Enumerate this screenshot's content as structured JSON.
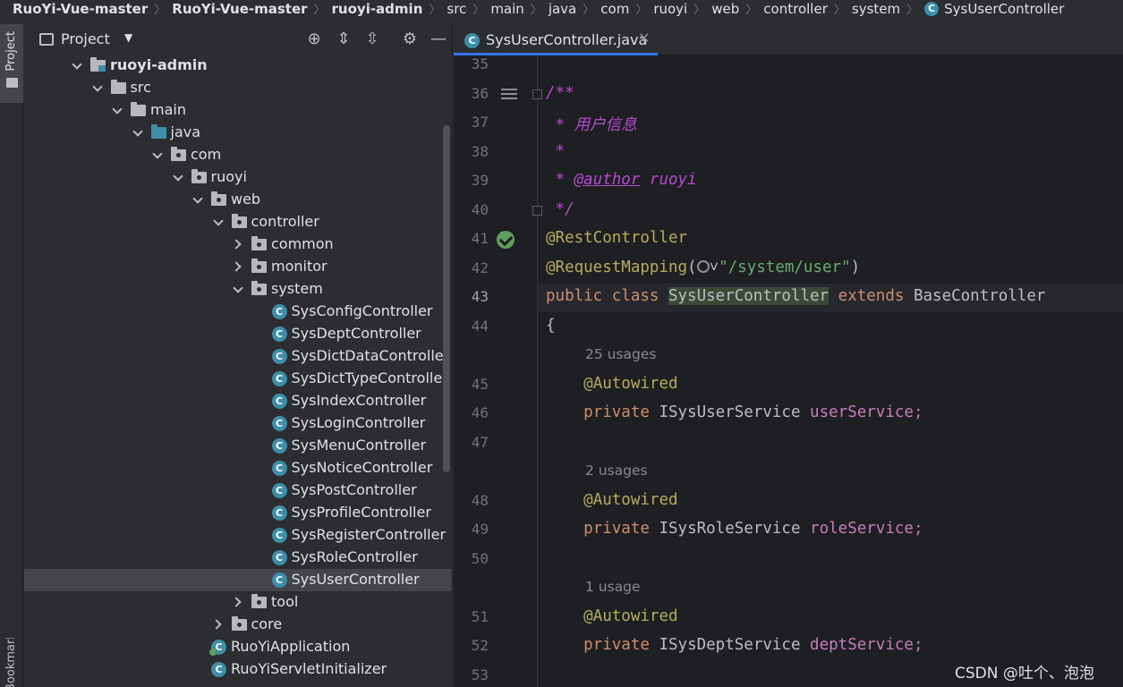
{
  "breadcrumb": [
    "RuoYi-Vue-master",
    "RuoYi-Vue-master",
    "ruoyi-admin",
    "src",
    "main",
    "java",
    "com",
    "ruoyi",
    "web",
    "controller",
    "system",
    "SysUserController"
  ],
  "toolstrip": {
    "project_label": "Project",
    "bookmarks_label": "Bookmarks"
  },
  "panel": {
    "title": "Project",
    "dropdown": "▼"
  },
  "tree": [
    {
      "label": "ruoyi-admin",
      "depth": 0,
      "kind": "module",
      "expanded": true,
      "bold": true
    },
    {
      "label": "src",
      "depth": 1,
      "kind": "folder",
      "expanded": true
    },
    {
      "label": "main",
      "depth": 2,
      "kind": "folder",
      "expanded": true
    },
    {
      "label": "java",
      "depth": 3,
      "kind": "src",
      "expanded": true
    },
    {
      "label": "com",
      "depth": 4,
      "kind": "pkg",
      "expanded": true
    },
    {
      "label": "ruoyi",
      "depth": 5,
      "kind": "pkg",
      "expanded": true
    },
    {
      "label": "web",
      "depth": 6,
      "kind": "pkg",
      "expanded": true
    },
    {
      "label": "controller",
      "depth": 7,
      "kind": "pkg",
      "expanded": true
    },
    {
      "label": "common",
      "depth": 8,
      "kind": "pkg",
      "expanded": false
    },
    {
      "label": "monitor",
      "depth": 8,
      "kind": "pkg",
      "expanded": false
    },
    {
      "label": "system",
      "depth": 8,
      "kind": "pkg",
      "expanded": true
    },
    {
      "label": "SysConfigController",
      "depth": 9,
      "kind": "class"
    },
    {
      "label": "SysDeptController",
      "depth": 9,
      "kind": "class"
    },
    {
      "label": "SysDictDataController",
      "depth": 9,
      "kind": "class"
    },
    {
      "label": "SysDictTypeController",
      "depth": 9,
      "kind": "class"
    },
    {
      "label": "SysIndexController",
      "depth": 9,
      "kind": "class"
    },
    {
      "label": "SysLoginController",
      "depth": 9,
      "kind": "class"
    },
    {
      "label": "SysMenuController",
      "depth": 9,
      "kind": "class"
    },
    {
      "label": "SysNoticeController",
      "depth": 9,
      "kind": "class"
    },
    {
      "label": "SysPostController",
      "depth": 9,
      "kind": "class"
    },
    {
      "label": "SysProfileController",
      "depth": 9,
      "kind": "class"
    },
    {
      "label": "SysRegisterController",
      "depth": 9,
      "kind": "class"
    },
    {
      "label": "SysRoleController",
      "depth": 9,
      "kind": "class"
    },
    {
      "label": "SysUserController",
      "depth": 9,
      "kind": "class",
      "selected": true
    },
    {
      "label": "tool",
      "depth": 8,
      "kind": "pkg",
      "expanded": false
    },
    {
      "label": "core",
      "depth": 7,
      "kind": "pkg",
      "expanded": false
    },
    {
      "label": "RuoYiApplication",
      "depth": 6,
      "kind": "app"
    },
    {
      "label": "RuoYiServletInitializer",
      "depth": 6,
      "kind": "class"
    }
  ],
  "editor": {
    "tab_label": "SysUserController.java",
    "lines": [
      {
        "num": "35",
        "code": ""
      },
      {
        "num": "36",
        "code": "/**"
      },
      {
        "num": "37",
        "code": " * 用户信息"
      },
      {
        "num": "38",
        "code": " *"
      },
      {
        "num": "39",
        "code": " * @author ruoyi"
      },
      {
        "num": "40",
        "code": " */"
      },
      {
        "num": "41",
        "code": "@RestController"
      },
      {
        "num": "42",
        "code": "@RequestMapping(\"/system/user\")"
      },
      {
        "num": "43",
        "code": "public class SysUserController extends BaseController"
      },
      {
        "num": "44",
        "code": "{"
      },
      {
        "num": "45",
        "code": "    @Autowired",
        "hint": "25 usages"
      },
      {
        "num": "46",
        "code": "    private ISysUserService userService;"
      },
      {
        "num": "47",
        "code": ""
      },
      {
        "num": "48",
        "code": "    @Autowired",
        "hint": "2 usages"
      },
      {
        "num": "49",
        "code": "    private ISysRoleService roleService;"
      },
      {
        "num": "50",
        "code": ""
      },
      {
        "num": "51",
        "code": "    @Autowired",
        "hint": "1 usage"
      },
      {
        "num": "52",
        "code": "    private ISysDeptService deptService;"
      },
      {
        "num": "53",
        "code": ""
      }
    ]
  },
  "watermark": "CSDN @吐个、泡泡"
}
